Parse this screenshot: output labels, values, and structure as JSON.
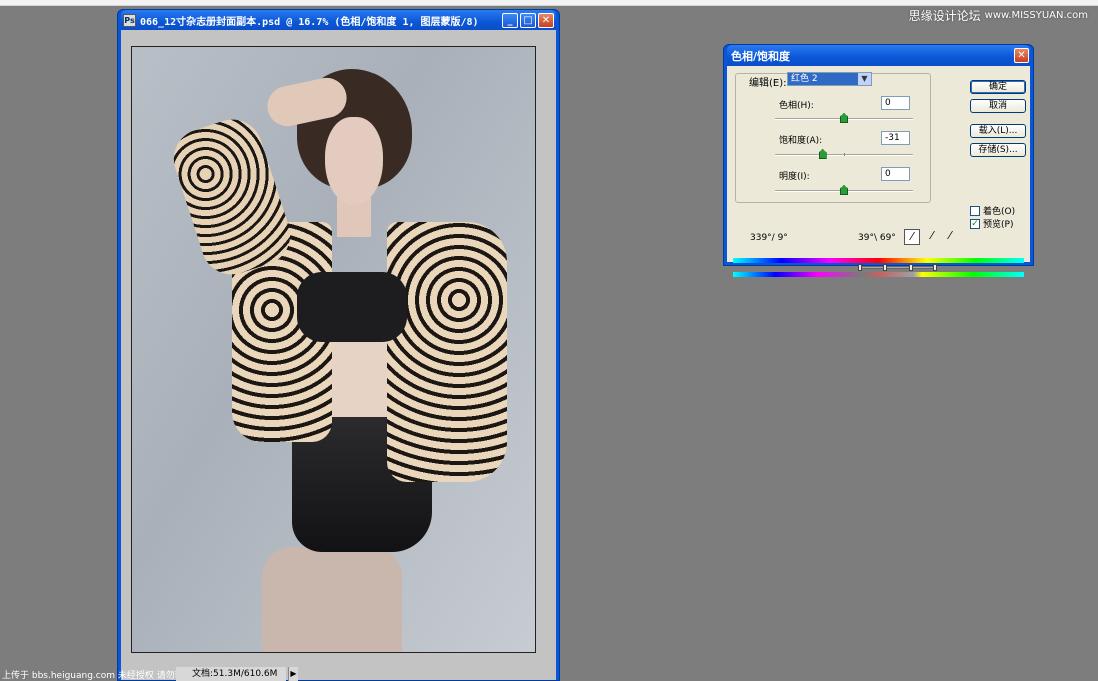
{
  "watermark": {
    "cn": "思缘设计论坛",
    "en": "www.MISSYUAN.com"
  },
  "document": {
    "title": "066_12寸杂志册封面副本.psd @ 16.7% (色相/饱和度 1, 图层蒙版/8)",
    "icon": "photoshop-doc-icon",
    "buttons": [
      "minimize",
      "maximize",
      "close"
    ]
  },
  "status": {
    "credit": "上传于 bbs.heiguang.com  未经授权 请勿转载",
    "doc_size": "文档:51.3M/610.6M",
    "arrow": "▶"
  },
  "dialog": {
    "title": "色相/饱和度",
    "edit_label": "编辑(E):",
    "edit_value": "红色 2",
    "hue": {
      "label": "色相(H):",
      "value": "0",
      "fraction": 0.5
    },
    "saturation": {
      "label": "饱和度(A):",
      "value": "-31",
      "fraction": 0.345
    },
    "lightness": {
      "label": "明度(I):",
      "value": "0",
      "fraction": 0.5
    },
    "buttons": {
      "ok": "确定",
      "cancel": "取消",
      "load": "载入(L)...",
      "save": "存储(S)..."
    },
    "colorize": {
      "label": "着色(O)",
      "checked": false
    },
    "preview": {
      "label": "预览(P)",
      "checked": true
    },
    "angle_left": "339°/ 9°",
    "angle_right": "39°\\ 69°",
    "eyedroppers": [
      "eyedropper-icon",
      "eyedropper-add-icon",
      "eyedropper-subtract-icon"
    ]
  }
}
